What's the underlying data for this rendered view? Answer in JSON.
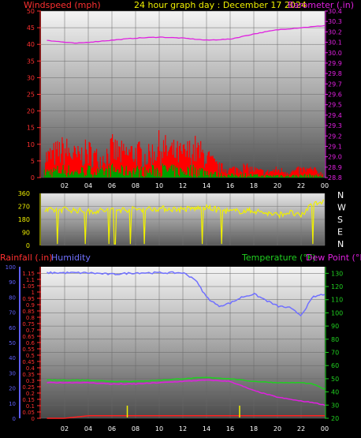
{
  "header": {
    "left_label": "Windspeed (mph)",
    "title": "24 hour graph day : December 17 2024",
    "right_label": "Barometer (.in)"
  },
  "colors": {
    "wind": "#ff0000",
    "gust_fill": "#00a000",
    "wind_light": "#c8ffc8",
    "barometer": "#e020e0",
    "direction": "#f0f000",
    "rain": "#ff2020",
    "humidity": "#7070ff",
    "temperature": "#20d020",
    "dewpoint": "#e020e0",
    "left_axis_red": "#ff3030",
    "axis_blue": "#6060ff",
    "axis_green": "#20d020"
  },
  "bottom_header": {
    "rain_label": "Rainfall (.in)",
    "humidity_label": "Humidity",
    "temp_label": "Temperature (°F)",
    "dew_label": "Dew Point (°F)"
  },
  "chart_data": [
    {
      "type": "line",
      "title": "24 hour graph day : December 17 2024",
      "xlabel": "",
      "x_ticks": [
        "02",
        "04",
        "06",
        "08",
        "10",
        "12",
        "14",
        "16",
        "18",
        "20",
        "22",
        "00"
      ],
      "y_left_label": "Windspeed (mph)",
      "y_left_ticks": [
        0,
        5,
        10,
        15,
        20,
        25,
        30,
        35,
        40,
        45,
        50
      ],
      "y_left_range": [
        0,
        50
      ],
      "y_right_label": "Barometer (.in)",
      "y_right_ticks": [
        28.8,
        28.9,
        29.0,
        29.1,
        29.2,
        29.3,
        29.4,
        29.5,
        29.6,
        29.7,
        29.8,
        29.9,
        30.0,
        30.1,
        30.2,
        30.3,
        30.4
      ],
      "y_right_range": [
        28.8,
        30.4
      ],
      "series": [
        {
          "name": "Windspeed (mph)",
          "axis": "left",
          "kind": "gust_spikes",
          "x": [
            0.5,
            1,
            2,
            3,
            4,
            5,
            6,
            7,
            8,
            9,
            10,
            11,
            12,
            13,
            14,
            15,
            16,
            17,
            18,
            19,
            20,
            21,
            22,
            23,
            24
          ],
          "values": [
            8,
            9,
            11,
            8,
            10,
            7,
            11,
            9,
            10,
            8,
            12,
            10,
            9,
            11,
            8,
            4,
            3,
            4,
            3,
            2,
            3,
            2,
            3,
            3,
            1
          ]
        },
        {
          "name": "Barometer (.in)",
          "axis": "right",
          "x": [
            0.5,
            2,
            3,
            4,
            6,
            8,
            10,
            12,
            14,
            16,
            18,
            20,
            22,
            24
          ],
          "values": [
            30.12,
            30.1,
            30.09,
            30.1,
            30.12,
            30.14,
            30.15,
            30.14,
            30.12,
            30.13,
            30.18,
            30.22,
            30.24,
            30.26
          ]
        }
      ]
    },
    {
      "type": "line",
      "title": "",
      "x_ticks": [],
      "y_left_ticks": [
        0,
        90,
        180,
        270,
        360
      ],
      "y_left_range": [
        0,
        360
      ],
      "y_right_ticks": [
        "N",
        "W",
        "S",
        "E",
        "N"
      ],
      "series": [
        {
          "name": "Wind direction",
          "x": [
            0.5,
            2,
            4,
            6,
            8,
            10,
            12,
            14,
            16,
            18,
            20,
            21,
            22,
            23,
            24
          ],
          "values": [
            240,
            250,
            235,
            245,
            250,
            255,
            250,
            260,
            235,
            240,
            210,
            230,
            200,
            300,
            300
          ]
        }
      ]
    },
    {
      "type": "line",
      "title": "",
      "x_ticks": [
        "02",
        "04",
        "06",
        "08",
        "10",
        "12",
        "14",
        "16",
        "18",
        "20",
        "22",
        "00"
      ],
      "y_left_label": "Rainfall (.in)",
      "y_left_ticks": [
        0,
        0.05,
        0.1,
        0.15,
        0.2,
        0.25,
        0.3,
        0.35,
        0.4,
        0.45,
        0.5,
        0.55,
        0.6,
        0.65,
        0.7,
        0.75,
        0.8,
        0.85,
        0.9,
        0.95,
        1,
        1.05,
        1.1,
        1.15
      ],
      "y_left_range": [
        0,
        1.2
      ],
      "y_humidity_ticks": [
        0,
        10,
        20,
        30,
        40,
        50,
        60,
        70,
        80,
        90,
        100
      ],
      "y_right_label": "Temperature (°F)",
      "y_right_ticks": [
        20,
        30,
        40,
        50,
        60,
        70,
        80,
        90,
        100,
        110,
        120,
        130
      ],
      "y_right_range": [
        20,
        135
      ],
      "series": [
        {
          "name": "Humidity",
          "axis": "humidity",
          "x": [
            0.5,
            2,
            4,
            6,
            8,
            10,
            12,
            13,
            14,
            15,
            16,
            17,
            18,
            19,
            20,
            21,
            22,
            23,
            24
          ],
          "values": [
            96,
            96,
            96,
            95,
            96,
            96,
            96,
            92,
            80,
            74,
            76,
            80,
            82,
            78,
            74,
            73,
            68,
            80,
            82
          ]
        },
        {
          "name": "Temperature (°F)",
          "axis": "right",
          "x": [
            0.5,
            2,
            4,
            6,
            8,
            10,
            12,
            14,
            16,
            18,
            20,
            22,
            23,
            24
          ],
          "values": [
            49,
            49,
            49,
            48,
            48,
            49,
            50,
            51,
            50,
            48,
            47,
            47,
            46,
            42
          ]
        },
        {
          "name": "Dew Point (°F)",
          "axis": "right",
          "x": [
            0.5,
            2,
            4,
            6,
            8,
            10,
            12,
            14,
            16,
            18,
            20,
            22,
            23,
            24
          ],
          "values": [
            47,
            47,
            47,
            46,
            46,
            47,
            48,
            49,
            48,
            41,
            36,
            33,
            32,
            30
          ]
        },
        {
          "name": "Rainfall (.in)",
          "axis": "left",
          "x": [
            0.5,
            2,
            3,
            4,
            6,
            8,
            10,
            12,
            14,
            16,
            18,
            20,
            22,
            24
          ],
          "values": [
            0,
            0,
            0.01,
            0.02,
            0.02,
            0.02,
            0.02,
            0.02,
            0.02,
            0.02,
            0.02,
            0.02,
            0.02,
            0.02
          ]
        }
      ]
    }
  ]
}
